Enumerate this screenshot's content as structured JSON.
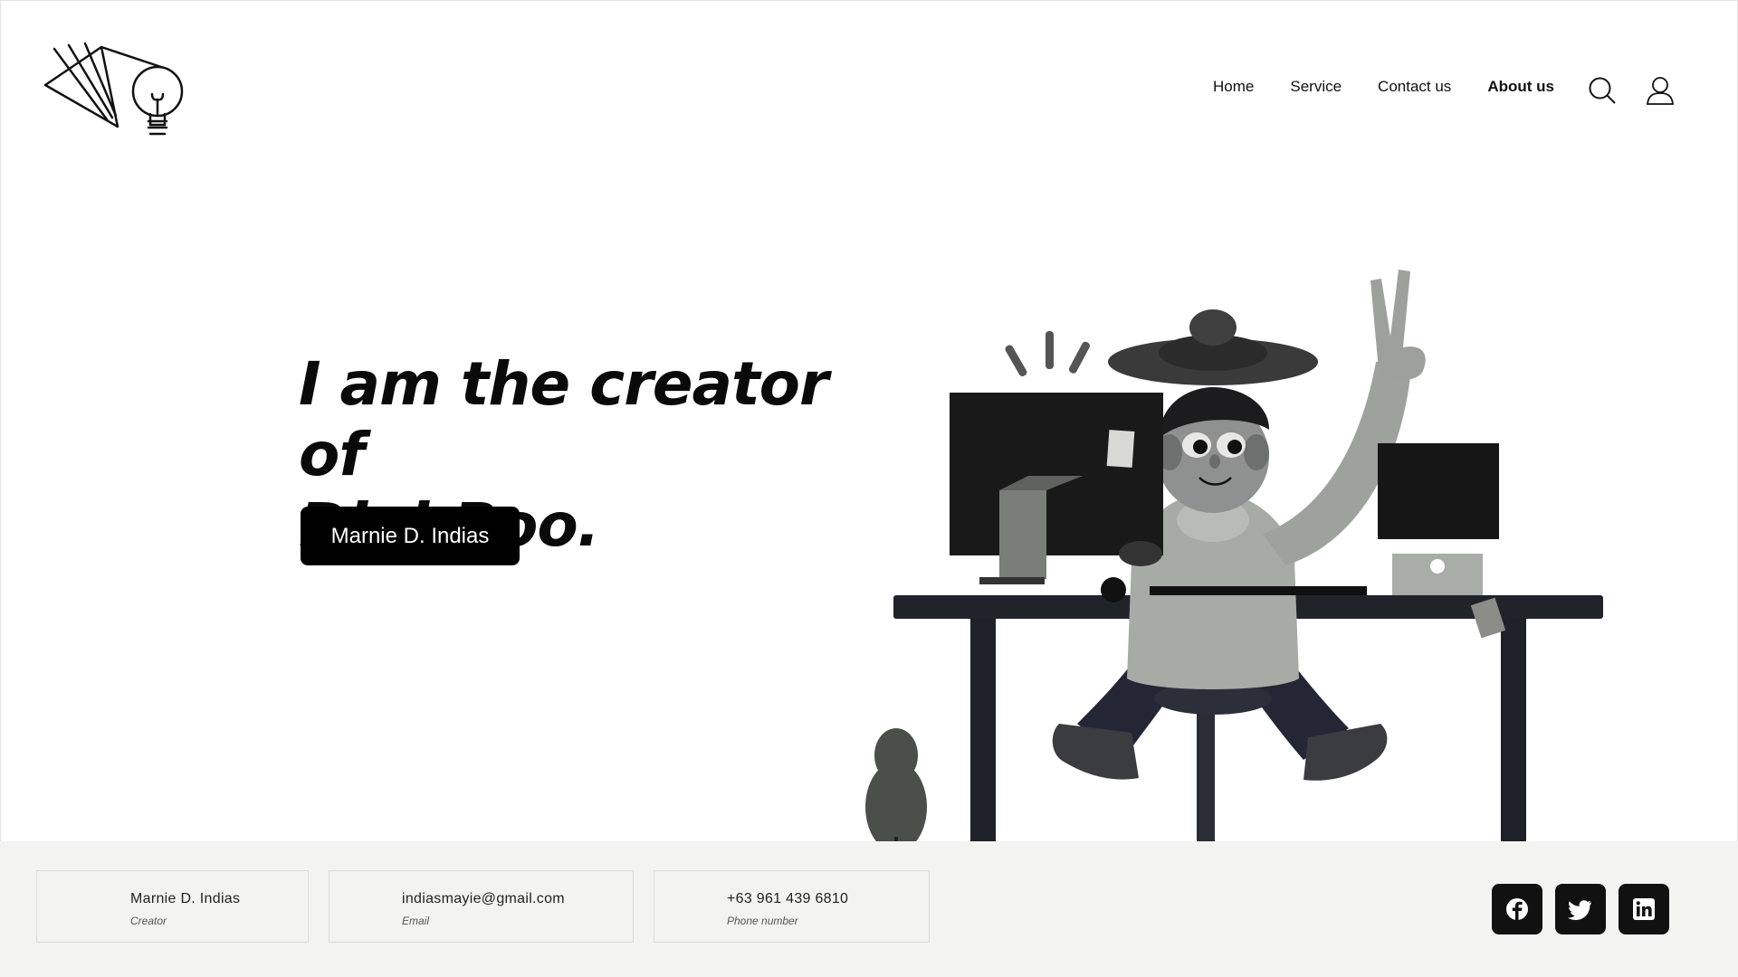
{
  "nav": {
    "items": [
      {
        "label": "Home",
        "active": false
      },
      {
        "label": "Service",
        "active": false
      },
      {
        "label": "Contact us",
        "active": false
      },
      {
        "label": "About us",
        "active": true
      }
    ],
    "icons": [
      "search-icon",
      "user-icon"
    ]
  },
  "hero": {
    "headline_line1": "I am the creator of",
    "headline_line2": "Digi-Boo.",
    "cta_label": "Marnie D. Indias"
  },
  "footer": {
    "profile": {
      "name": "Marnie D. Indias",
      "role": "Creator"
    },
    "email": {
      "value": "indiasmayie@gmail.com",
      "label": "Email"
    },
    "phone": {
      "value": "+63 961 439 6810",
      "label": "Phone number"
    },
    "social": [
      "facebook-icon",
      "twitter-icon",
      "linkedin-icon"
    ]
  },
  "colors": {
    "accent": "#000000",
    "footer_bg": "#f3f3f1",
    "text": "#111111"
  }
}
